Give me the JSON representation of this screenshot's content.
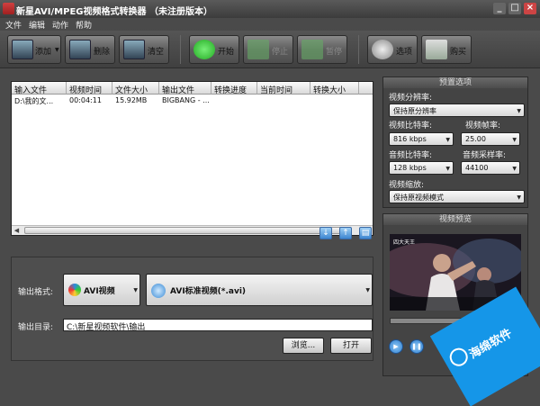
{
  "window": {
    "title": "新星AVI/MPEG视频格式转换器 （未注册版本）"
  },
  "menu": [
    "文件",
    "编辑",
    "动作",
    "帮助"
  ],
  "toolbar": {
    "add": "添加",
    "delete": "删除",
    "clear": "清空",
    "start": "开始",
    "stop": "停止",
    "pause": "暂停",
    "options": "选项",
    "buy": "购买"
  },
  "file_list": {
    "columns": [
      "输入文件",
      "视频时间",
      "文件大小",
      "输出文件",
      "转换进度",
      "当前时间",
      "转换大小"
    ],
    "rows": [
      [
        "D:\\我的文...",
        "00:04:11",
        "15.92MB",
        "BIGBANG - ...",
        "",
        "",
        ""
      ]
    ]
  },
  "output": {
    "format_label": "输出格式:",
    "format_category": "AVI视频",
    "format_value": "AVI标准视频(*.avi)",
    "dir_label": "输出目录:",
    "dir_value": "C:\\新星视频软件\\输出",
    "browse": "浏览...",
    "open": "打开"
  },
  "presets": {
    "title": "预置选项",
    "resolution_label": "视频分辨率:",
    "resolution_value": "保持原分辨率",
    "vbitrate_label": "视频比特率:",
    "vbitrate_value": "816 kbps",
    "framerate_label": "视频帧率:",
    "framerate_value": "25.00",
    "abitrate_label": "音频比特率:",
    "abitrate_value": "128 kbps",
    "samplerate_label": "音频采样率:",
    "samplerate_value": "44100",
    "scale_label": "视频缩放:",
    "scale_value": "保持原视频模式"
  },
  "preview": {
    "title": "视频预览",
    "overlay": "四大天王"
  },
  "watermark": {
    "text": "海绵软件"
  },
  "colors": {
    "accent_blue": "#1596e8",
    "toolbar_bg": "#4a4a4a"
  }
}
